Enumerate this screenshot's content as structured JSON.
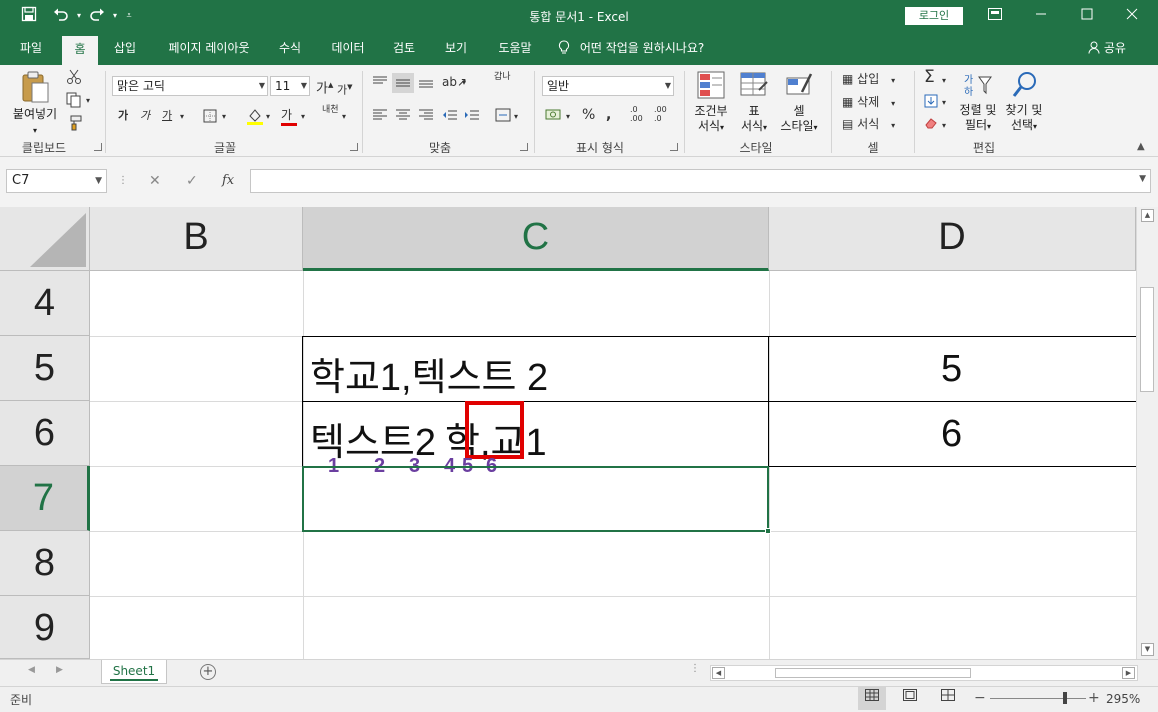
{
  "titlebar": {
    "title": "통합 문서1  -  Excel",
    "login": "로그인",
    "icons": [
      "save-icon",
      "undo-icon",
      "redo-icon",
      "customize-icon",
      "ribbon-display-icon",
      "minimize-icon",
      "maximize-icon",
      "close-icon"
    ]
  },
  "tabs": {
    "items": [
      "파일",
      "홈",
      "삽입",
      "페이지 레이아웃",
      "수식",
      "데이터",
      "검토",
      "보기",
      "도움말"
    ],
    "active": "홈",
    "tellme": "어떤 작업을 원하시나요?",
    "share": "공유"
  },
  "ribbon": {
    "clipboard": {
      "label": "클립보드",
      "paste": "붙여넣기"
    },
    "font": {
      "label": "글꼴",
      "name": "맑은 고딕",
      "size": "11",
      "bold": "가",
      "italic": "가",
      "underline": "가",
      "phonetic": "내천"
    },
    "alignment": {
      "label": "맞춤",
      "wrap": "갑나"
    },
    "number": {
      "label": "표시 형식",
      "format": "일반"
    },
    "styles": {
      "label": "스타일",
      "conditional_1": "조건부",
      "conditional_2": "서식",
      "table_1": "표",
      "table_2": "서식",
      "cell_1": "셀",
      "cell_2": "스타일"
    },
    "cells": {
      "label": "셀",
      "insert": "삽입",
      "delete": "삭제",
      "format": "서식"
    },
    "editing": {
      "label": "편집",
      "sort_1": "정렬 및",
      "sort_2": "필터",
      "find_1": "찾기 및",
      "find_2": "선택"
    }
  },
  "formula_bar": {
    "name_box": "C7",
    "formula": ""
  },
  "grid": {
    "columns": [
      "B",
      "C",
      "D"
    ],
    "selected_column": "C",
    "rows": [
      "4",
      "5",
      "6",
      "7",
      "8",
      "9"
    ],
    "selected_row": "7",
    "cells": {
      "C5": "학교1,텍스트 2",
      "D5": "5",
      "C6_a": "텍스트2",
      "C6_b": "학",
      "C6_c": ",",
      "C6_d": "교1",
      "D6": "6"
    },
    "markers": [
      "1",
      "2",
      "3",
      "4",
      "5",
      "6"
    ],
    "colors": {
      "active_border": "#217346",
      "highlight_box": "#e00000",
      "marker_text": "#6b3fa0"
    }
  },
  "sheets": {
    "tabs": [
      "Sheet1"
    ],
    "active": "Sheet1"
  },
  "status": {
    "ready": "준비",
    "zoom": "295%"
  }
}
